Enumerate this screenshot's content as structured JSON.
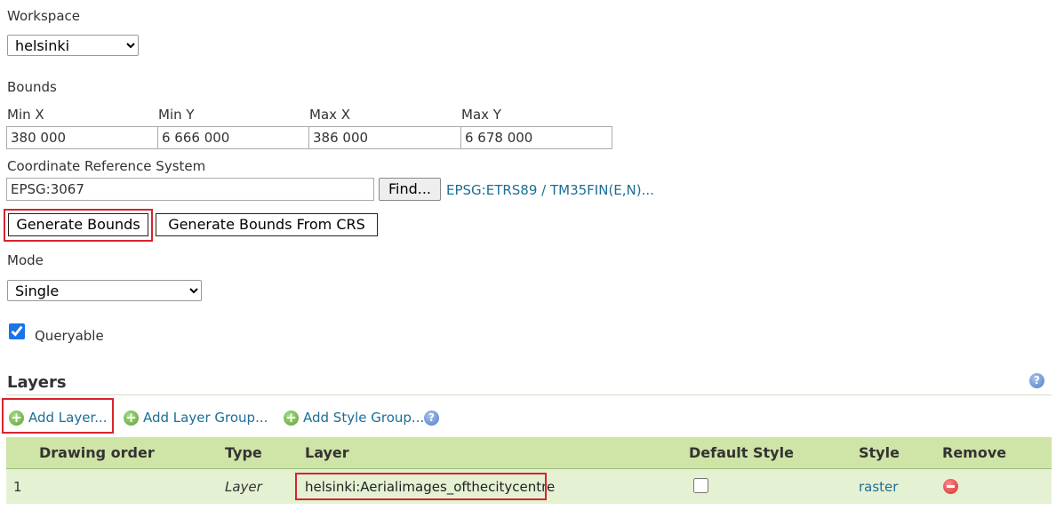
{
  "workspace": {
    "label": "Workspace",
    "value": "helsinki"
  },
  "bounds": {
    "label": "Bounds",
    "min_x_label": "Min X",
    "min_x": "380 000",
    "min_y_label": "Min Y",
    "min_y": "6 666 000",
    "max_x_label": "Max X",
    "max_x": "386 000",
    "max_y_label": "Max Y",
    "max_y": "6 678 000"
  },
  "crs": {
    "label": "Coordinate Reference System",
    "value": "EPSG:3067",
    "find_label": "Find...",
    "link": "EPSG:ETRS89 / TM35FIN(E,N)..."
  },
  "buttons": {
    "generate_bounds": "Generate Bounds",
    "generate_bounds_crs": "Generate Bounds From CRS"
  },
  "mode": {
    "label": "Mode",
    "value": "Single"
  },
  "queryable": {
    "label": "Queryable",
    "checked": true
  },
  "layers": {
    "title": "Layers",
    "add_layer": "Add Layer...",
    "add_layer_group": "Add Layer Group...",
    "add_style_group": "Add Style Group...",
    "columns": [
      "Drawing order",
      "Type",
      "Layer",
      "Default Style",
      "Style",
      "Remove"
    ],
    "rows": [
      {
        "order": "1",
        "type": "Layer",
        "layer": "helsinki:Aerialimages_ofthecitycentre",
        "style": "raster"
      }
    ]
  },
  "colors": {
    "table_header": "#cfe4a7",
    "table_row": "#e5f1d3",
    "highlight": "#d9232d",
    "link": "#1c6e95"
  }
}
